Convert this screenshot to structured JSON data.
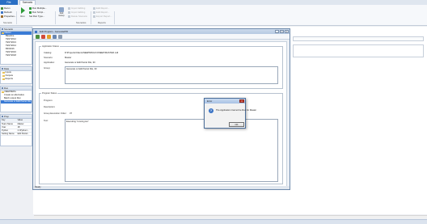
{
  "ribbon": {
    "file_tab": "File",
    "home_tab": "Scenario",
    "group_left": {
      "items": [
        "Rerun",
        "Refresh",
        "Properties..."
      ],
      "label": "Scenario"
    },
    "run_button": "Run",
    "run_items": [
      "Run Multiple...",
      "Run Script...",
      "Set Run Type..."
    ],
    "group_run_label": "Run",
    "add_group": "Add Group",
    "scenarios_items": [
      "Import Editing",
      "Import Editing",
      "Delete Scenario"
    ],
    "scenarios_label": "Scenarios",
    "reports_items": [
      "Edit Report...",
      "Edit Report...",
      "Export Report..."
    ],
    "reports_label": "Reports"
  },
  "scenarios_pane": {
    "title": "Scenario",
    "root": "Master",
    "items": [
      "Baseline",
      "TEST2012",
      "TEST2013",
      "TEST2014",
      "BIO2016",
      "TEST2016",
      "TEST2018"
    ]
  },
  "data_pane": {
    "title": "Data",
    "items": [
      "Inputs",
      "Outputs",
      "Reports"
    ]
  },
  "run_pane": {
    "title": "Run",
    "items": [
      "NEEPMWG",
      "Create an alternative",
      "Batch output Run",
      "Generate or Edit Parcel File"
    ]
  },
  "props_pane": {
    "title": "Prop",
    "header": [
      "Key",
      "Value"
    ],
    "rows": [
      [
        "Team Name",
        "Master"
      ],
      [
        "Year",
        "18"
      ],
      [
        "Python",
        "C:\\Python\\..."
      ],
      [
        "Setting Name",
        "Edit Parcel..."
      ]
    ]
  },
  "edit_window": {
    "title": "Edit Program - GeneratePID",
    "application_status": "Application Status",
    "catalog_label": "Catalog:",
    "catalog_value": "D:\\Projects\\Clients\\NEEPMWG\\CONEEP\\MASTER.mdl",
    "scenario_label": "Scenario:",
    "scenario_value": "Master",
    "application_label": "Application:",
    "application_value": "Generate or Edit Parcel File, 30",
    "group_label": "Group:",
    "group_value": "Generate or Edit Parcel File, 30",
    "program_status": "Program Status",
    "program_label": "Program:",
    "description_label": "Description:",
    "group_exec_label": "Group Execution Order:",
    "group_exec_value": "37",
    "text_label": "Text:",
    "text_value": "Executing \"running tex\"",
    "status": "Ready"
  },
  "dialog": {
    "title": "Error",
    "message": "The Application Cannot be Run for Master",
    "ok": "OK"
  }
}
